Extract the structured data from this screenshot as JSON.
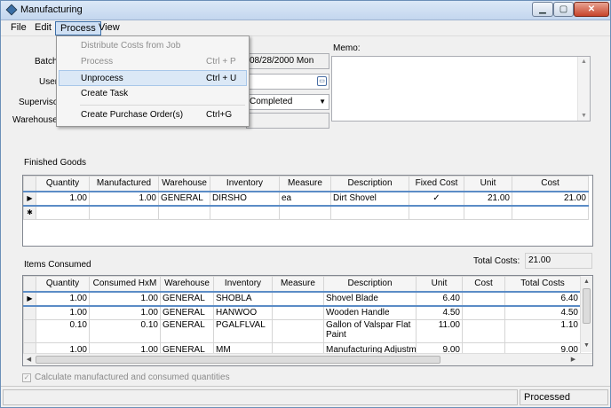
{
  "window": {
    "title": "Manufacturing"
  },
  "menubar": [
    {
      "label": "File"
    },
    {
      "label": "Edit"
    },
    {
      "label": "Process"
    },
    {
      "label": "View"
    }
  ],
  "process_menu": {
    "items": [
      {
        "label": "Distribute Costs from Job",
        "shortcut": "",
        "enabled": false
      },
      {
        "label": "Process",
        "shortcut": "Ctrl + P",
        "enabled": false
      },
      {
        "label": "Unprocess",
        "shortcut": "Ctrl + U",
        "enabled": true,
        "highlighted": true
      },
      {
        "label": "Create Task",
        "shortcut": "",
        "enabled": true
      },
      {
        "label": "Create Purchase Order(s)",
        "shortcut": "Ctrl+G",
        "enabled": true
      }
    ]
  },
  "form": {
    "batch_label": "Batch",
    "user_label": "User",
    "supervisor_label": "Superviso",
    "warehouse_label": "Warehouse",
    "date_value": "08/28/2000 Mon",
    "status_value": "Completed",
    "memo_label": "Memo:",
    "memo_value": ""
  },
  "finished_goods": {
    "label": "Finished Goods",
    "columns": [
      "Quantity",
      "Manufactured",
      "Warehouse",
      "Inventory",
      "Measure",
      "Description",
      "Fixed Cost",
      "Unit",
      "Cost"
    ],
    "rows": [
      {
        "quantity": "1.00",
        "manufactured": "1.00",
        "warehouse": "GENERAL",
        "inventory": "DIRSHO",
        "measure": "ea",
        "description": "Dirt Shovel",
        "fixed_cost": "✓",
        "unit": "21.00",
        "cost": "21.00"
      }
    ]
  },
  "totals": {
    "label": "Total Costs:",
    "value": "21.00"
  },
  "items_consumed": {
    "label": "Items Consumed",
    "columns": [
      "Quantity",
      "Consumed HxM",
      "Warehouse",
      "Inventory",
      "Measure",
      "Description",
      "Unit",
      "Cost",
      "Total Costs"
    ],
    "rows": [
      {
        "quantity": "1.00",
        "consumed": "1.00",
        "warehouse": "GENERAL",
        "inventory": "SHOBLA",
        "measure": "",
        "description": "Shovel Blade",
        "unit": "6.40",
        "cost": "",
        "total": "6.40"
      },
      {
        "quantity": "1.00",
        "consumed": "1.00",
        "warehouse": "GENERAL",
        "inventory": "HANWOO",
        "measure": "",
        "description": "Wooden Handle",
        "unit": "4.50",
        "cost": "",
        "total": "4.50"
      },
      {
        "quantity": "0.10",
        "consumed": "0.10",
        "warehouse": "GENERAL",
        "inventory": "PGALFLVAL",
        "measure": "",
        "description": "Gallon of Valspar Flat Paint",
        "unit": "11.00",
        "cost": "",
        "total": "1.10"
      },
      {
        "quantity": "1.00",
        "consumed": "1.00",
        "warehouse": "GENERAL",
        "inventory": "MM",
        "measure": "",
        "description": "Manufacturing Adjustment",
        "unit": "9.00",
        "cost": "",
        "total": "9.00"
      }
    ]
  },
  "options": {
    "calc_label": "Calculate manufactured and consumed quantities",
    "calc_checked": true
  },
  "status": {
    "text": "Processed"
  }
}
